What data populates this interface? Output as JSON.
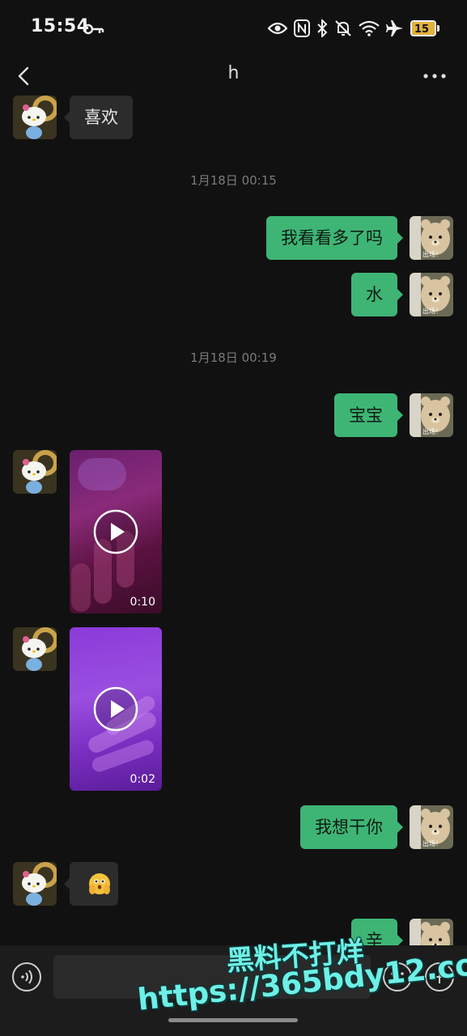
{
  "status_bar": {
    "time": "15:54",
    "battery_level": "15",
    "icons": [
      "key-icon",
      "eye-icon",
      "nfc-icon",
      "bluetooth-icon",
      "mute-bell-icon",
      "wifi-icon",
      "airplane-icon",
      "battery-icon"
    ]
  },
  "header": {
    "title": "h"
  },
  "messages": {
    "m1": {
      "text": "喜欢"
    },
    "t1": {
      "text": "1月18日 00:15"
    },
    "m2": {
      "text": "我看看多了吗"
    },
    "m3": {
      "text": "水"
    },
    "t2": {
      "text": "1月18日 00:19"
    },
    "m4": {
      "text": "宝宝"
    },
    "v1": {
      "duration": "0:10"
    },
    "v2": {
      "duration": "0:02"
    },
    "m5": {
      "text": "我想干你"
    },
    "m6": {
      "emoji": "🫣"
    },
    "m7": {
      "text": "辛"
    }
  },
  "avatars": {
    "outgoing_caption": "出场！"
  },
  "input": {
    "value": ""
  },
  "watermark": {
    "line1": "黑料不打烊",
    "line2": "https://365bdy12.com"
  },
  "colors": {
    "background": "#111111",
    "bubble_outgoing": "#3eb575",
    "bubble_incoming": "#2c2c2c",
    "watermark": "#6ef0e6"
  }
}
